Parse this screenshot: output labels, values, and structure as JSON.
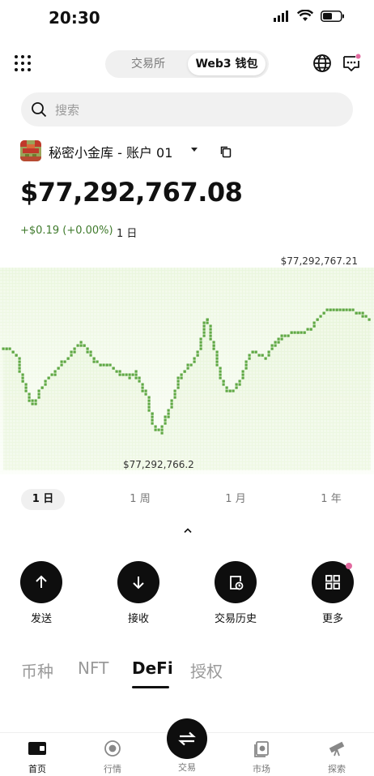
{
  "status_bar": {
    "time": "20:30"
  },
  "header": {
    "tabs": [
      {
        "label": "交易所"
      },
      {
        "label": "Web3 钱包"
      }
    ]
  },
  "search": {
    "placeholder": "搜索"
  },
  "account": {
    "name": "秘密小金库 - 账户 01",
    "balance": "$77,292,767.08",
    "pnl": "+$0.19 (+0.00%)",
    "pnl_period": "1 日"
  },
  "chart": {
    "high_label": "$77,292,767.21",
    "low_label": "$77,292,766.2"
  },
  "chart_data": {
    "type": "line",
    "title": "",
    "x": [
      0,
      1,
      2,
      3,
      4,
      5,
      6,
      7,
      8,
      9,
      10,
      11,
      12,
      13,
      14,
      15,
      16,
      17,
      18,
      19,
      20,
      21,
      22,
      23,
      24,
      25,
      26,
      27,
      28,
      29,
      30,
      31,
      32,
      33,
      34,
      35,
      36,
      37,
      38,
      39,
      40,
      41,
      42,
      43,
      44,
      45,
      46,
      47,
      48,
      49,
      50,
      51,
      52,
      53,
      54,
      55,
      56
    ],
    "values": [
      766.81,
      766.81,
      766.78,
      766.62,
      766.5,
      766.47,
      766.58,
      766.64,
      766.67,
      766.73,
      766.76,
      766.81,
      766.85,
      766.8,
      766.73,
      766.71,
      766.71,
      766.69,
      766.65,
      766.64,
      766.67,
      766.59,
      766.51,
      766.33,
      766.3,
      766.4,
      766.51,
      766.64,
      766.69,
      766.73,
      766.81,
      767.0,
      766.84,
      766.67,
      766.55,
      766.56,
      766.6,
      766.71,
      766.8,
      766.78,
      766.76,
      766.82,
      766.87,
      766.89,
      766.91,
      766.92,
      766.92,
      766.93,
      767.0,
      767.04,
      767.05,
      767.06,
      767.05,
      767.05,
      767.03,
      767.02,
      766.99
    ],
    "value_prefix": "$77,292,",
    "ylim": [
      766.2,
      767.21
    ],
    "grid": false,
    "color": "#5fa844"
  },
  "periods": [
    {
      "label": "1 日"
    },
    {
      "label": "1 周"
    },
    {
      "label": "1 月"
    },
    {
      "label": "1 年"
    }
  ],
  "actions": [
    {
      "label": "发送",
      "icon": "arrow-up-icon"
    },
    {
      "label": "接收",
      "icon": "arrow-down-icon"
    },
    {
      "label": "交易历史",
      "icon": "history-icon"
    },
    {
      "label": "更多",
      "icon": "apps-grid-icon"
    }
  ],
  "asset_tabs": [
    {
      "label": "币种"
    },
    {
      "label": "NFT"
    },
    {
      "label": "DeFi"
    },
    {
      "label": "授权"
    }
  ],
  "nav": [
    {
      "label": "首页",
      "icon": "wallet-icon"
    },
    {
      "label": "行情",
      "icon": "market-icon"
    },
    {
      "label": "交易",
      "icon": "swap-icon"
    },
    {
      "label": "市场",
      "icon": "marketplace-icon"
    },
    {
      "label": "探索",
      "icon": "telescope-icon"
    }
  ],
  "colors": {
    "accent": "#111111",
    "positive": "#3f7a2c",
    "badge": "#e26aa0",
    "chart_line": "#5fa844"
  }
}
